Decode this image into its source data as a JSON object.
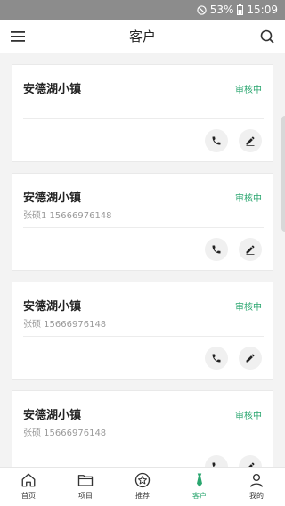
{
  "status_bar": {
    "battery": "53%",
    "time": "15:09"
  },
  "header": {
    "title": "客户"
  },
  "customers": [
    {
      "name": "安德湖小镇",
      "status": "审核中",
      "contact": ""
    },
    {
      "name": "安德湖小镇",
      "status": "审核中",
      "contact": "张硕1   15666976148"
    },
    {
      "name": "安德湖小镇",
      "status": "审核中",
      "contact": "张硕   15666976148"
    },
    {
      "name": "安德湖小镇",
      "status": "审核中",
      "contact": "张硕   15666976148"
    }
  ],
  "tabs": [
    {
      "label": "首页",
      "icon": "home-icon"
    },
    {
      "label": "项目",
      "icon": "folder-icon"
    },
    {
      "label": "推荐",
      "icon": "star-icon"
    },
    {
      "label": "客户",
      "icon": "tie-icon",
      "active": true
    },
    {
      "label": "我的",
      "icon": "person-icon"
    }
  ],
  "colors": {
    "accent": "#2aa66f",
    "status_bar": "#8c8c8c"
  }
}
